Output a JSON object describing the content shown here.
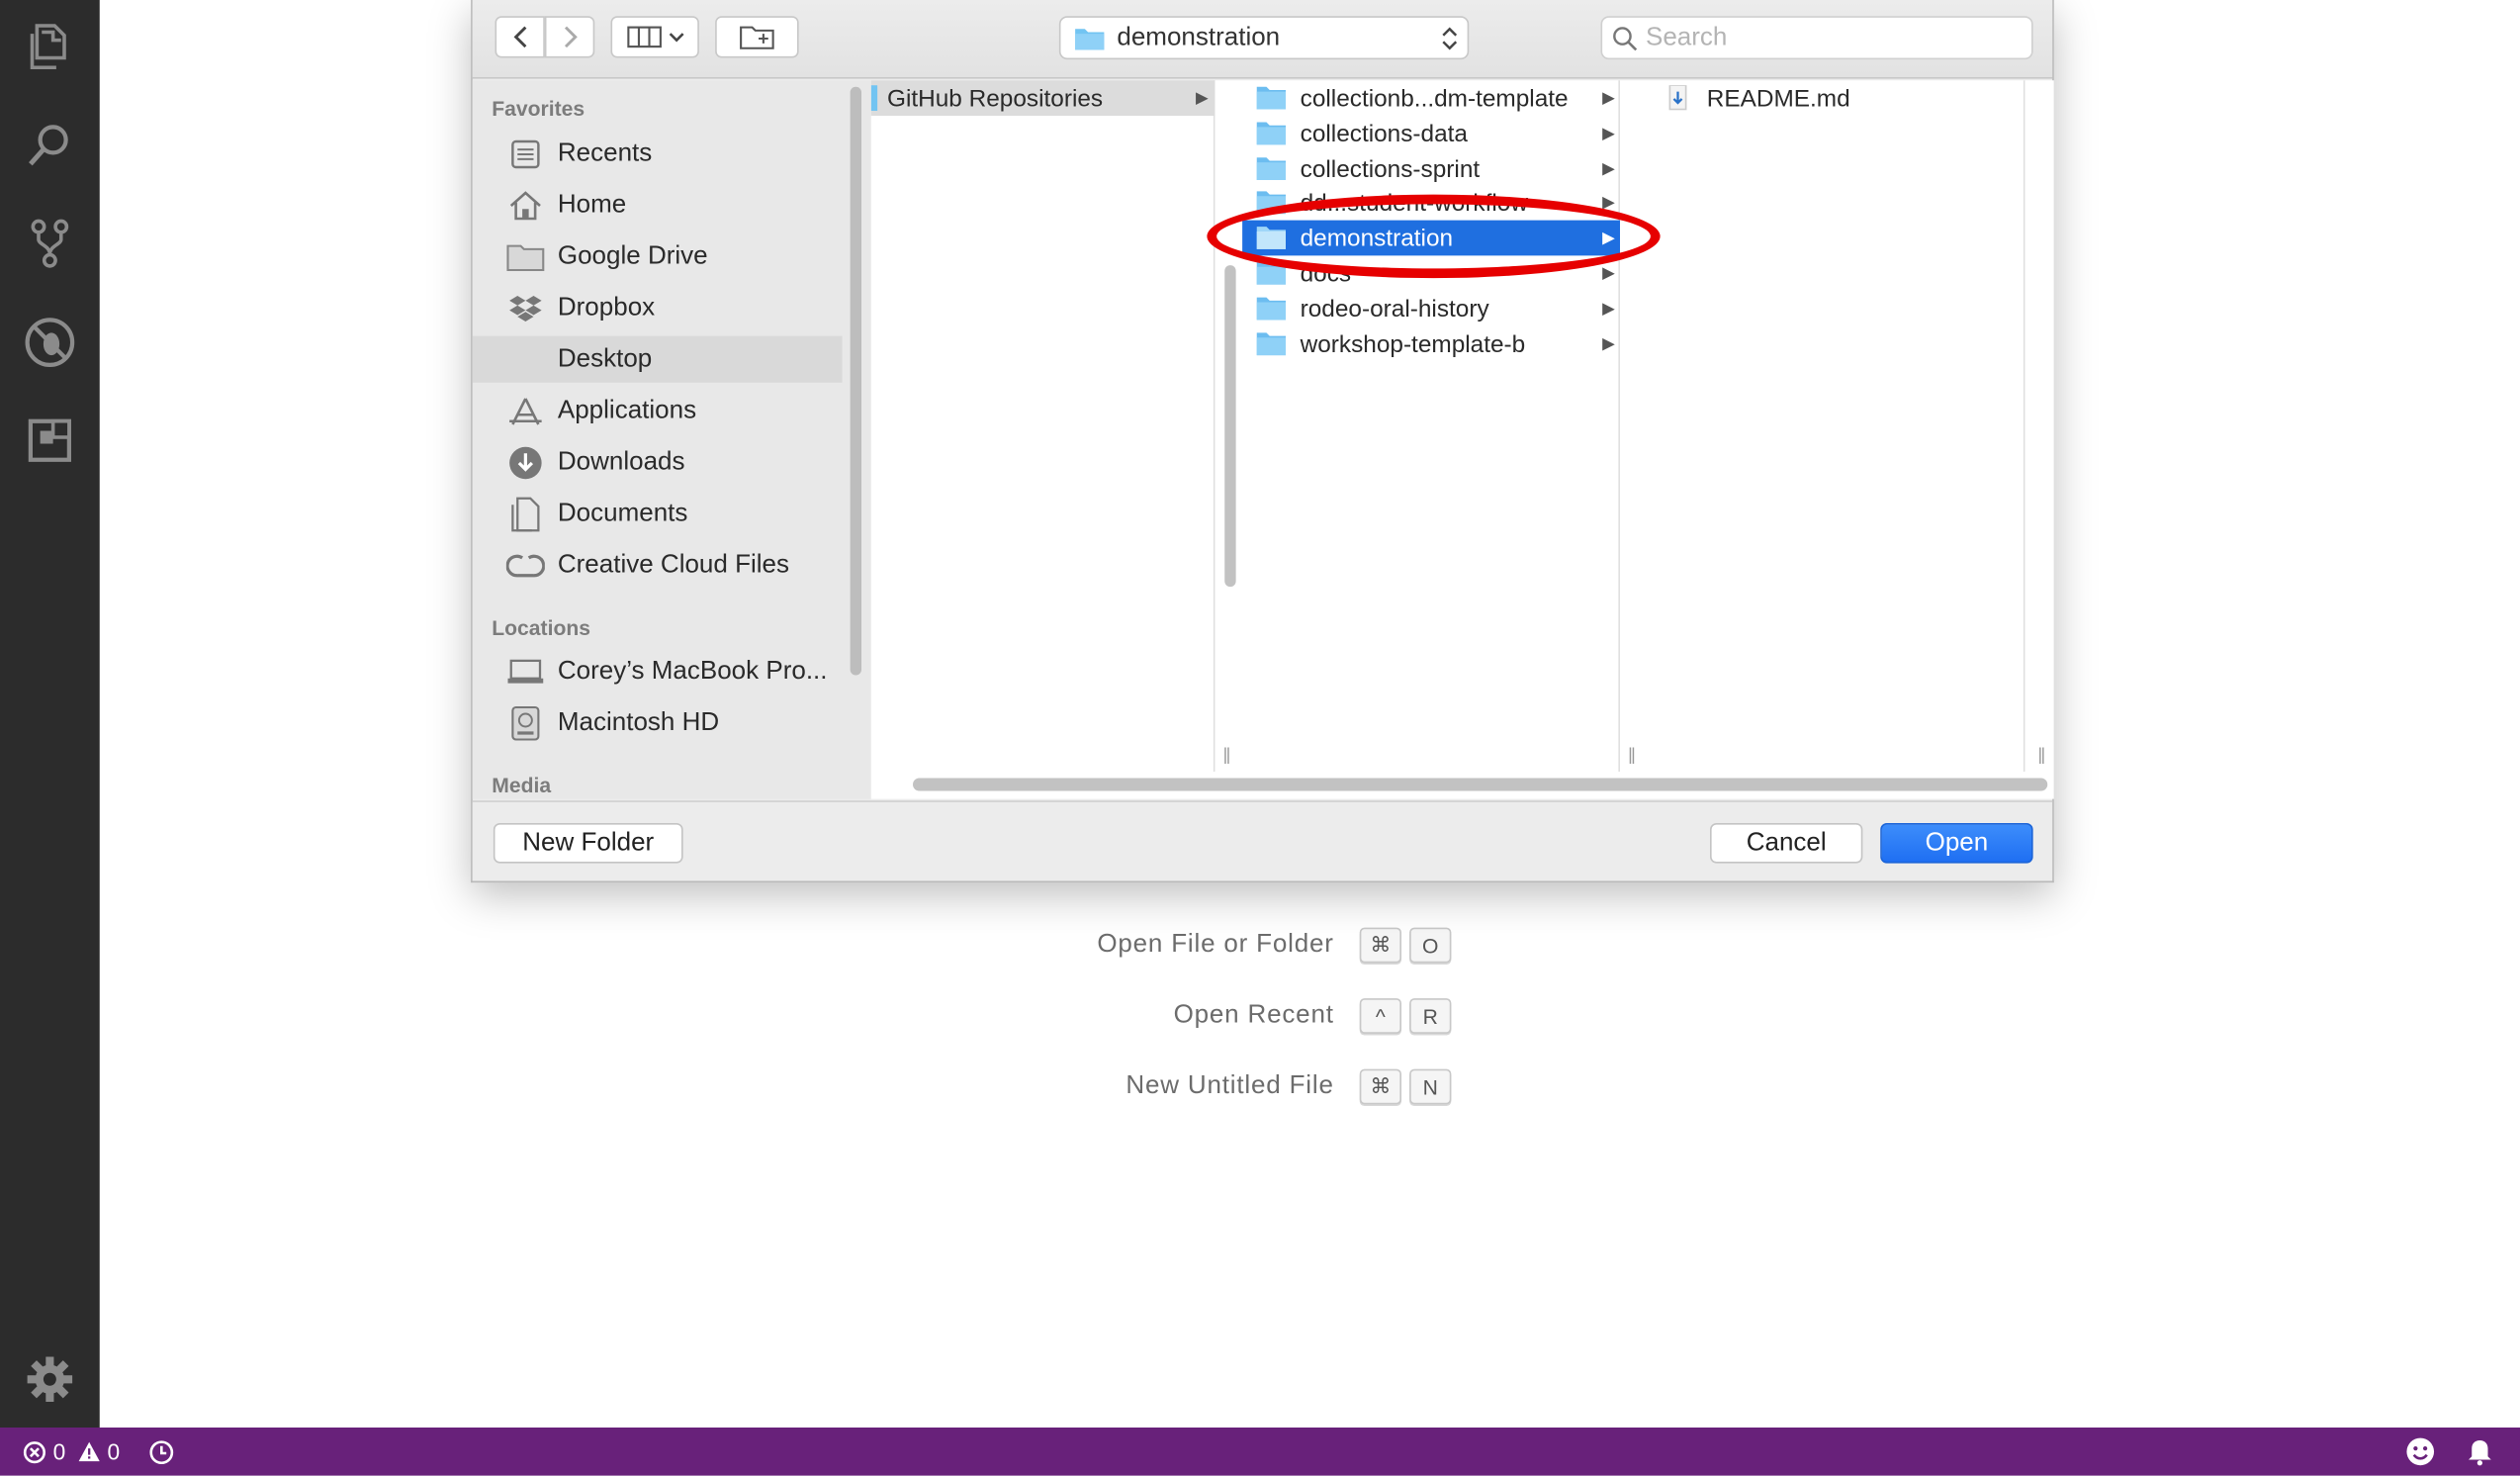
{
  "activity_bar": {
    "icons": [
      "explorer-icon",
      "search-icon",
      "source-control-icon",
      "debug-icon",
      "extensions-icon"
    ],
    "settings_icon": "gear-icon"
  },
  "welcome": {
    "shortcuts": [
      {
        "label": "Open File or Folder",
        "keys": [
          "⌘",
          "O"
        ]
      },
      {
        "label": "Open Recent",
        "keys": [
          "^",
          "R"
        ]
      },
      {
        "label": "New Untitled File",
        "keys": [
          "⌘",
          "N"
        ]
      }
    ]
  },
  "status_bar": {
    "errors": "0",
    "warnings": "0",
    "bg_color": "#68217a"
  },
  "dialog": {
    "path_popup": "demonstration",
    "search_placeholder": "Search",
    "sidebar": {
      "favorites_label": "Favorites",
      "favorites": [
        {
          "label": "Recents",
          "icon": "recents-icon"
        },
        {
          "label": "Home",
          "icon": "home-icon"
        },
        {
          "label": "Google Drive",
          "icon": "folder-icon"
        },
        {
          "label": "Dropbox",
          "icon": "dropbox-icon"
        },
        {
          "label": "Desktop",
          "icon": "desktop-icon",
          "selected": true
        },
        {
          "label": "Applications",
          "icon": "applications-icon"
        },
        {
          "label": "Downloads",
          "icon": "downloads-icon"
        },
        {
          "label": "Documents",
          "icon": "documents-icon"
        },
        {
          "label": "Creative Cloud Files",
          "icon": "creative-cloud-icon"
        }
      ],
      "locations_label": "Locations",
      "locations": [
        {
          "label": "Corey’s MacBook Pro...",
          "icon": "laptop-icon"
        },
        {
          "label": "Macintosh HD",
          "icon": "harddrive-icon"
        }
      ],
      "media_label": "Media"
    },
    "columns": {
      "col1": [
        "GitHub Repositories"
      ],
      "col2": [
        "collectionb...dm-template",
        "collections-data",
        "collections-sprint",
        "dd...student-workflow",
        "demonstration",
        "docs",
        "rodeo-oral-history",
        "workshop-template-b"
      ],
      "col2_selected": "demonstration",
      "col3": [
        "README.md"
      ]
    },
    "buttons": {
      "new_folder": "New Folder",
      "cancel": "Cancel",
      "open": "Open"
    },
    "accent_color": "#1f6fe0"
  }
}
